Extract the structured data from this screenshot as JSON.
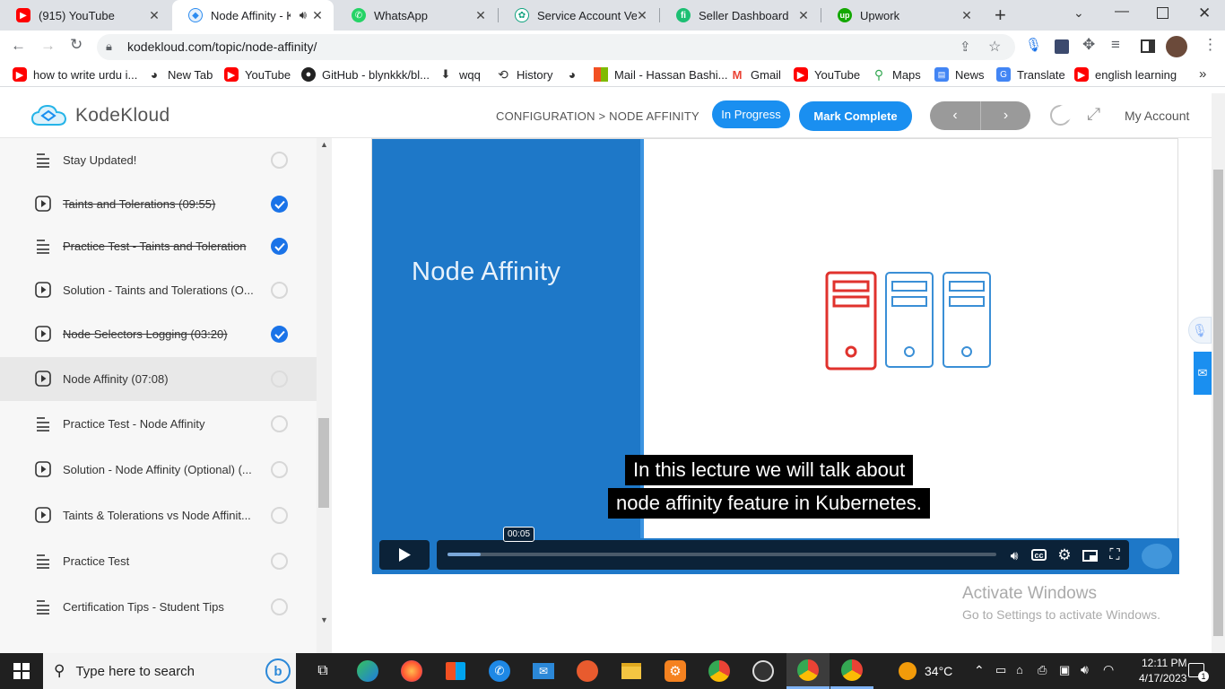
{
  "browser": {
    "tabs": [
      {
        "title": "(915) YouTube",
        "icon": "youtube-icon",
        "color": "#ff0000",
        "active": false
      },
      {
        "title": "Node Affinity - Ko",
        "icon": "kodekloud-icon",
        "color": "#2d8cf0",
        "active": true
      },
      {
        "title": "WhatsApp",
        "icon": "whatsapp-icon",
        "color": "#25d366",
        "active": false
      },
      {
        "title": "Service Account Versio",
        "icon": "openai-icon",
        "color": "#10a37f",
        "active": false
      },
      {
        "title": "Seller Dashboard",
        "icon": "fiverr-icon",
        "color": "#1dbf73",
        "active": false
      },
      {
        "title": "Upwork",
        "icon": "upwork-icon",
        "color": "#14a800",
        "active": false
      }
    ],
    "url": "kodekloud.com/topic/node-affinity/",
    "bookmarks": [
      {
        "label": "how to write urdu i...",
        "icon": "youtube-icon",
        "color": "#ff0000"
      },
      {
        "label": "New Tab",
        "icon": "globe-icon",
        "color": "#333333"
      },
      {
        "label": "YouTube",
        "icon": "youtube-icon",
        "color": "#ff0000"
      },
      {
        "label": "GitHub - blynkkk/bl...",
        "icon": "github-icon",
        "color": "#222222"
      },
      {
        "label": "wqq",
        "icon": "download-icon",
        "color": "#333333"
      },
      {
        "label": "History",
        "icon": "history-icon",
        "color": "#333333"
      },
      {
        "label": "",
        "icon": "globe-icon",
        "color": "#333333"
      },
      {
        "label": "Mail - Hassan Bashi...",
        "icon": "microsoft-icon",
        "color": "#f25022"
      },
      {
        "label": "Gmail",
        "icon": "gmail-icon",
        "color": "#ea4335"
      },
      {
        "label": "YouTube",
        "icon": "youtube-icon",
        "color": "#ff0000"
      },
      {
        "label": "Maps",
        "icon": "maps-icon",
        "color": "#34a853"
      },
      {
        "label": "News",
        "icon": "news-icon",
        "color": "#4285f4"
      },
      {
        "label": "Translate",
        "icon": "translate-icon",
        "color": "#4285f4"
      },
      {
        "label": "english learning",
        "icon": "youtube-icon",
        "color": "#ff0000"
      }
    ]
  },
  "header": {
    "logo_text": "KodeKloud",
    "breadcrumb": "CONFIGURATION > NODE AFFINITY",
    "in_progress_label": "In Progress",
    "mark_complete_label": "Mark Complete",
    "prev_label": "‹",
    "next_label": "›",
    "account_label": "My Account",
    "accent_color": "#1a8ff0"
  },
  "sidebar": {
    "lessons": [
      {
        "title": "Stay Updated!",
        "type": "text",
        "status": "open"
      },
      {
        "title": "Taints and Tolerations (09:55)",
        "type": "video",
        "status": "done"
      },
      {
        "title": "Practice Test - Taints and Toleration",
        "type": "text",
        "status": "done"
      },
      {
        "title": "Solution - Taints and Tolerations (O...",
        "type": "video",
        "status": "open"
      },
      {
        "title": "Node Selectors Logging (03:20)",
        "type": "video",
        "status": "done"
      },
      {
        "title": "Node Affinity (07:08)",
        "type": "video",
        "status": "current"
      },
      {
        "title": "Practice Test - Node Affinity",
        "type": "text",
        "status": "open"
      },
      {
        "title": "Solution - Node Affinity (Optional) (...",
        "type": "video",
        "status": "open"
      },
      {
        "title": "Taints & Tolerations vs Node Affinit...",
        "type": "video",
        "status": "open"
      },
      {
        "title": "Practice Test",
        "type": "text",
        "status": "open"
      },
      {
        "title": "Certification Tips - Student Tips",
        "type": "text",
        "status": "open"
      }
    ]
  },
  "video": {
    "slide_title": "Node Affinity",
    "caption_line1": "In this lecture we will talk about",
    "caption_line2": "node affinity feature in Kubernetes.",
    "current_time": "00:05",
    "progress": 0.06,
    "buffered": 0.06
  },
  "watermark": {
    "line1": "Activate Windows",
    "line2": "Go to Settings to activate Windows."
  },
  "taskbar": {
    "search_placeholder": "Type here to search",
    "weather": "34°C",
    "time": "12:11 PM",
    "date": "4/17/2023",
    "notification_count": "1"
  }
}
